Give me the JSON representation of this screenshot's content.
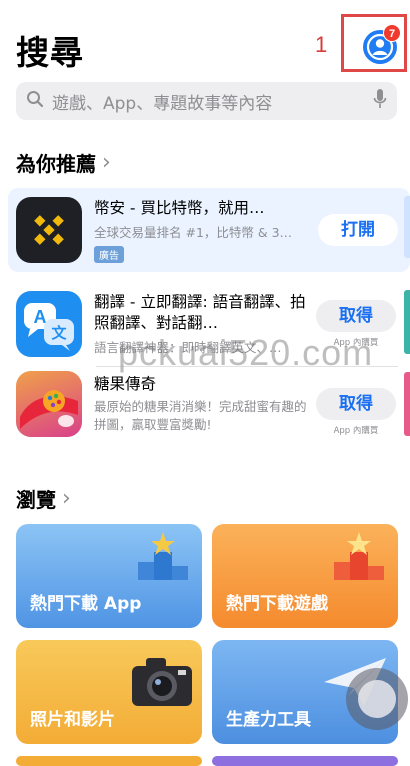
{
  "header": {
    "title": "搜尋",
    "annotation_number": "1",
    "notification_count": "7"
  },
  "search": {
    "placeholder": "遊戲、App、專題故事等內容"
  },
  "recommended": {
    "title": "為你推薦",
    "apps": [
      {
        "name": "幣安 - 買比特幣，就用…",
        "subtitle": "全球交易量排名 #1，比特幣 & 3…",
        "tag": "廣告",
        "action": "打開",
        "note": ""
      },
      {
        "name": "翻譯 - 立即翻譯: 語音翻譯、拍照翻譯、對話翻…",
        "subtitle": "語言翻譯神器：即時翻譯英文、…",
        "tag": "",
        "action": "取得",
        "note": "App 內購買"
      },
      {
        "name": "糖果傳奇",
        "subtitle": "最原始的糖果消消樂！完成甜蜜有趣的拼圖，贏取豐富獎勵!",
        "tag": "",
        "action": "取得",
        "note": "App 內購買"
      }
    ]
  },
  "browse": {
    "title": "瀏覽",
    "cards": [
      {
        "label": "熱門下載 App"
      },
      {
        "label": "熱門下載遊戲"
      },
      {
        "label": "照片和影片"
      },
      {
        "label": "生產力工具"
      }
    ]
  },
  "watermark": "pckuai520.com",
  "colors": {
    "accent": "#1a6ff2",
    "badge": "#ef3a2d",
    "annotation": "#e04848"
  }
}
